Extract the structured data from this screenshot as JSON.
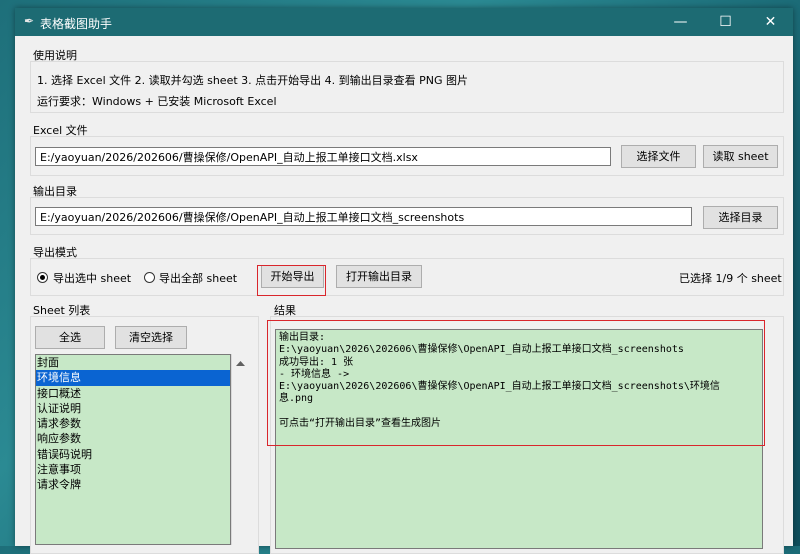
{
  "window": {
    "title": "表格截图助手",
    "controls": {
      "minimize": "—",
      "maximize": "☐",
      "close": "✕"
    }
  },
  "instructions": {
    "label": "使用说明",
    "line1": "1. 选择 Excel 文件  2. 读取并勾选 sheet  3. 点击开始导出  4. 到输出目录查看 PNG 图片",
    "line2": "运行要求：Windows + 已安装 Microsoft Excel"
  },
  "excel": {
    "label": "Excel 文件",
    "path": "E:/yaoyuan/2026/202606/曹操保修/OpenAPI_自动上报工单接口文档.xlsx",
    "choose_button": "选择文件",
    "read_button": "读取 sheet"
  },
  "output": {
    "label": "输出目录",
    "path": "E:/yaoyuan/2026/202606/曹操保修/OpenAPI_自动上报工单接口文档_screenshots",
    "choose_button": "选择目录"
  },
  "mode": {
    "label": "导出模式",
    "option_selected": "导出选中 sheet",
    "option_all": "导出全部 sheet",
    "selected_option": "导出选中 sheet",
    "start_button": "开始导出",
    "open_dir_button": "打开输出目录",
    "status": "已选择 1/9 个 sheet"
  },
  "sheets": {
    "label": "Sheet 列表",
    "select_all_button": "全选",
    "clear_button": "清空选择",
    "items": [
      "封面",
      "环境信息",
      "接口概述",
      "认证说明",
      "请求参数",
      "响应参数",
      "错误码说明",
      "注意事项",
      "请求令牌"
    ],
    "selected": "环境信息"
  },
  "result": {
    "label": "结果",
    "lines": [
      "输出目录:",
      "E:\\yaoyuan\\2026\\202606\\曹操保修\\OpenAPI_自动上报工单接口文档_screenshots",
      "成功导出: 1 张",
      "- 环境信息 ->",
      "E:\\yaoyuan\\2026\\202606\\曹操保修\\OpenAPI_自动上报工单接口文档_screenshots\\环境信",
      "息.png",
      "",
      "可点击“打开输出目录”查看生成图片"
    ]
  },
  "colors": {
    "titlebar": "#1d6b73",
    "list_bg": "#c7e8c7",
    "selection": "#0a64d2",
    "highlight_box": "#d9262c"
  }
}
